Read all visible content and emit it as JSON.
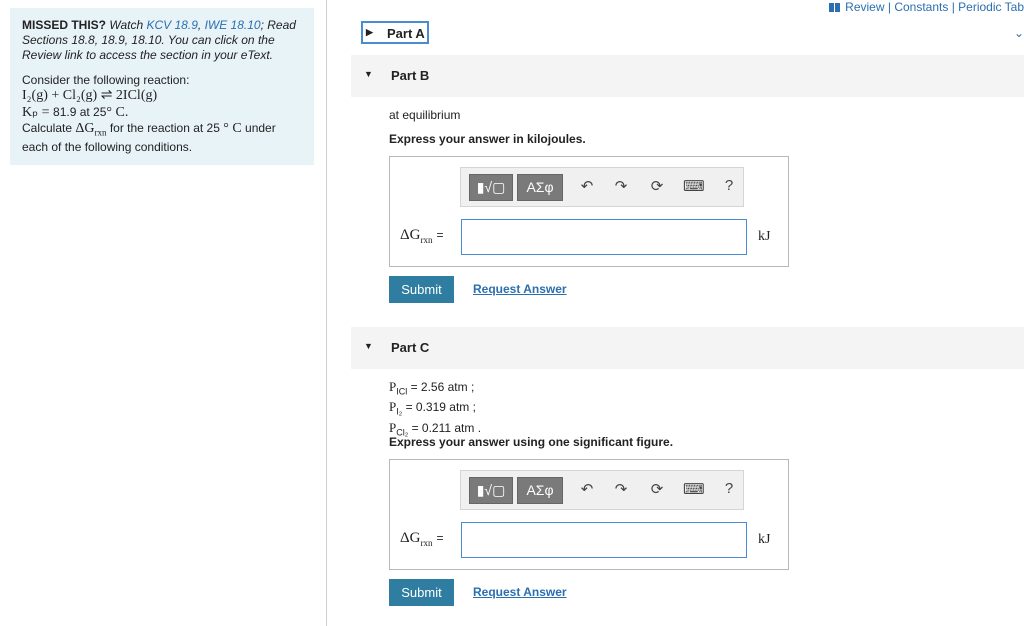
{
  "nav": {
    "review": "Review",
    "sep1": "|",
    "constants": "Constants",
    "sep2": "|",
    "periodic": "Periodic Tab"
  },
  "intro": {
    "missed_label": "MISSED THIS?",
    "watch": "Watch",
    "link1": "KCV 18.9",
    "comma": ",",
    "link2": "IWE 18.10",
    "read": "; Read Sections 18.8, 18.9, 18.10. You can click on the Review link to access the section in your eText.",
    "consider": "Consider the following reaction:",
    "reaction": "I₂(g) + Cl₂(g) ⇌ 2ICl(g)",
    "kp_symbol": "Kₚ = ",
    "kp_value": "81.9 at 25",
    "kp_unit": "° C.",
    "calc_pre": "Calculate ",
    "calc_sym": "ΔG",
    "calc_sub": "rxn",
    "calc_post": " for the reaction at 25 ",
    "calc_post2": "° C",
    "calc_post3": " under each of the following conditions."
  },
  "parts": {
    "a": {
      "label": "Part A"
    },
    "b": {
      "label": "Part B",
      "condition": "at equilibrium",
      "instruction": "Express your answer in kilojoules.",
      "unit": "kJ",
      "submit": "Submit",
      "request": "Request Answer"
    },
    "c": {
      "label": "Part C",
      "p1_sym": "P",
      "p1_sub": "ICl",
      "p1_val": " = 2.56 atm ;",
      "p2_sym": "P",
      "p2_sub": "I₂",
      "p2_val": " = 0.319 atm ;",
      "p3_sym": "P",
      "p3_sub": "Cl₂",
      "p3_val": " = 0.211 atm .",
      "instruction": "Express your answer using one significant figure.",
      "unit": "kJ",
      "submit": "Submit",
      "request": "Request Answer"
    }
  },
  "answer": {
    "sym": "ΔG",
    "sub": "rxn",
    "eq": "="
  },
  "toolbar": {
    "templates": "▮√▢",
    "greek": "ΑΣφ",
    "undo": "↶",
    "redo": "↷",
    "reset": "⟳",
    "keyboard": "⌨",
    "help": "?"
  },
  "icons": {
    "book": "book-icon",
    "expand": "triangle-right-icon",
    "collapse": "triangle-down-icon",
    "chevron": "chevron-down-icon"
  },
  "colors": {
    "accent": "#2a6fb0",
    "submit": "#2f7ea1",
    "panel": "#e8f3f8"
  }
}
